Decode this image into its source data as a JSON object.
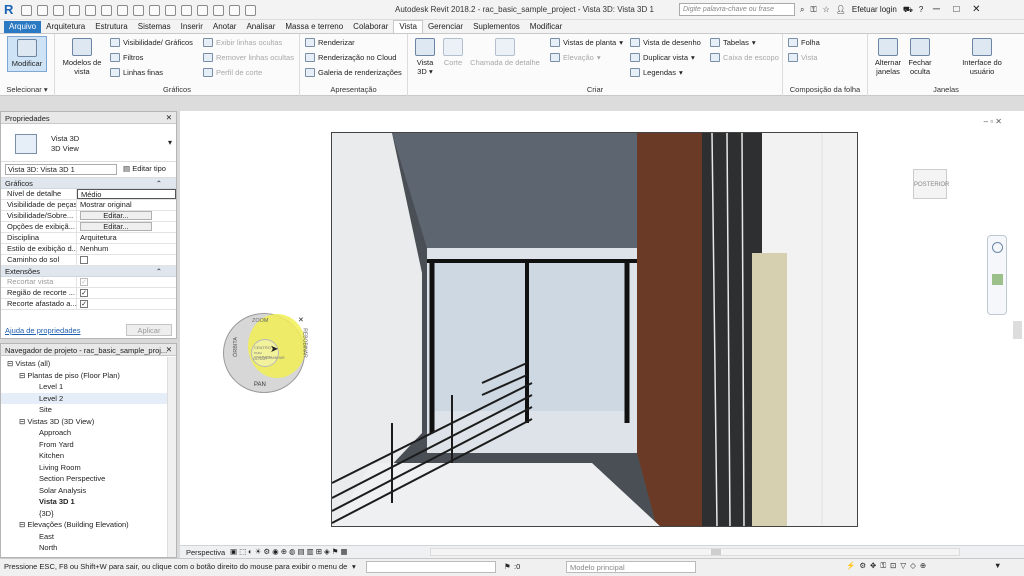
{
  "titlebar": {
    "title": "Autodesk Revit 2018.2 -   rac_basic_sample_project - Vista 3D: Vista 3D 1",
    "search_placeholder": "Digite palavra-chave ou frase",
    "login": "Efetuar login"
  },
  "tabs": [
    "Arquivo",
    "Arquitetura",
    "Estrutura",
    "Sistemas",
    "Inserir",
    "Anotar",
    "Analisar",
    "Massa e terreno",
    "Colaborar",
    "Vista",
    "Gerenciar",
    "Suplementos",
    "Modificar"
  ],
  "ribbon": {
    "select": {
      "modify": "Modificar",
      "label": "Selecionar"
    },
    "graficos": {
      "label": "Gráficos",
      "modelos": "Modelos de vista",
      "visib": "Visibilidade/ Gráficos",
      "filtros": "Filtros",
      "linhas_finas": "Linhas finas",
      "exibir": "Exibir linhas ocultas",
      "remover": "Remover linhas ocultas",
      "perfil": "Perfil de corte"
    },
    "apresentacao": {
      "label": "Apresentação",
      "renderizar": "Renderizar",
      "cloud": "Renderização no Cloud",
      "galeria": "Galeria de renderizações"
    },
    "criar": {
      "label": "Criar",
      "vista3d": "Vista 3D",
      "corte": "Corte",
      "chamada": "Chamada de detalhe",
      "plantas": "Vistas de planta",
      "elevacao": "Elevação",
      "desenho": "Vista de desenho",
      "duplicar": "Duplicar vista",
      "legendas": "Legendas",
      "tabelas": "Tabelas",
      "caixa": "Caixa de escopo"
    },
    "folha": {
      "label": "Composição da folha",
      "folha": "Folha",
      "vista": "Vista"
    },
    "janelas": {
      "label": "Janelas",
      "alternar": "Alternar janelas",
      "fechar": "Fechar oculta",
      "interface": "Interface do usuário"
    }
  },
  "properties": {
    "title": "Propriedades",
    "type_name": "Vista 3D",
    "type_sub": "3D View",
    "selector": "Vista 3D: Vista 3D 1",
    "edit_type": "Editar tipo",
    "cat_graficos": "Gráficos",
    "rows": [
      {
        "k": "Nível de detalhe",
        "v": "Médio"
      },
      {
        "k": "Visibilidade de peças",
        "v": "Mostrar original"
      },
      {
        "k": "Visibilidade/Sobre...",
        "v": "Editar..."
      },
      {
        "k": "Opções de exibiçã...",
        "v": "Editar..."
      },
      {
        "k": "Disciplina",
        "v": "Arquitetura"
      },
      {
        "k": "Estilo de exibição d...",
        "v": "Nenhum"
      },
      {
        "k": "Caminho do sol",
        "v": ""
      }
    ],
    "cat_extensoes": "Extensões",
    "rows2": [
      {
        "k": "Recortar vista",
        "v": ""
      },
      {
        "k": "Região de recorte ...",
        "v": ""
      },
      {
        "k": "Recorte afastado a...",
        "v": ""
      }
    ],
    "help": "Ajuda de propriedades",
    "apply": "Aplicar"
  },
  "browser": {
    "title": "Navegador de projeto - rac_basic_sample_proj...",
    "items": [
      {
        "t": "Vistas (all)",
        "lvl": 0,
        "ex": "⊟"
      },
      {
        "t": "Plantas de piso (Floor Plan)",
        "lvl": 1,
        "ex": "⊟"
      },
      {
        "t": "Level 1",
        "lvl": 2
      },
      {
        "t": "Level 2",
        "lvl": 2,
        "sel": true
      },
      {
        "t": "Site",
        "lvl": 2
      },
      {
        "t": "Vistas 3D (3D View)",
        "lvl": 1,
        "ex": "⊟"
      },
      {
        "t": "Approach",
        "lvl": 2
      },
      {
        "t": "From Yard",
        "lvl": 2
      },
      {
        "t": "Kitchen",
        "lvl": 2
      },
      {
        "t": "Living Room",
        "lvl": 2
      },
      {
        "t": "Section Perspective",
        "lvl": 2
      },
      {
        "t": "Solar Analysis",
        "lvl": 2
      },
      {
        "t": "Vista 3D 1",
        "lvl": 2,
        "bold": true
      },
      {
        "t": "{3D}",
        "lvl": 2
      },
      {
        "t": "Elevações (Building Elevation)",
        "lvl": 1,
        "ex": "⊟"
      },
      {
        "t": "East",
        "lvl": 2
      },
      {
        "t": "North",
        "lvl": 2
      }
    ]
  },
  "wheel": {
    "zoom": "ZOOM",
    "orbit": "ÓRBITA",
    "pan": "PAN",
    "rewind": "REBOBINAR",
    "center": "CENTRO",
    "look": "OLHAR",
    "updown": "PARA CIMA/BAIXO",
    "walk": "CAMINHAR"
  },
  "viewcube": {
    "face": "POSTERIOR"
  },
  "viewbar": {
    "mode": "Perspectiva"
  },
  "status": {
    "text": "Pressione ESC, F8 ou Shift+W para sair, ou clique com o botão direito do mouse para exibir o menu de",
    "zero": ":0",
    "model": "Modelo principal"
  }
}
